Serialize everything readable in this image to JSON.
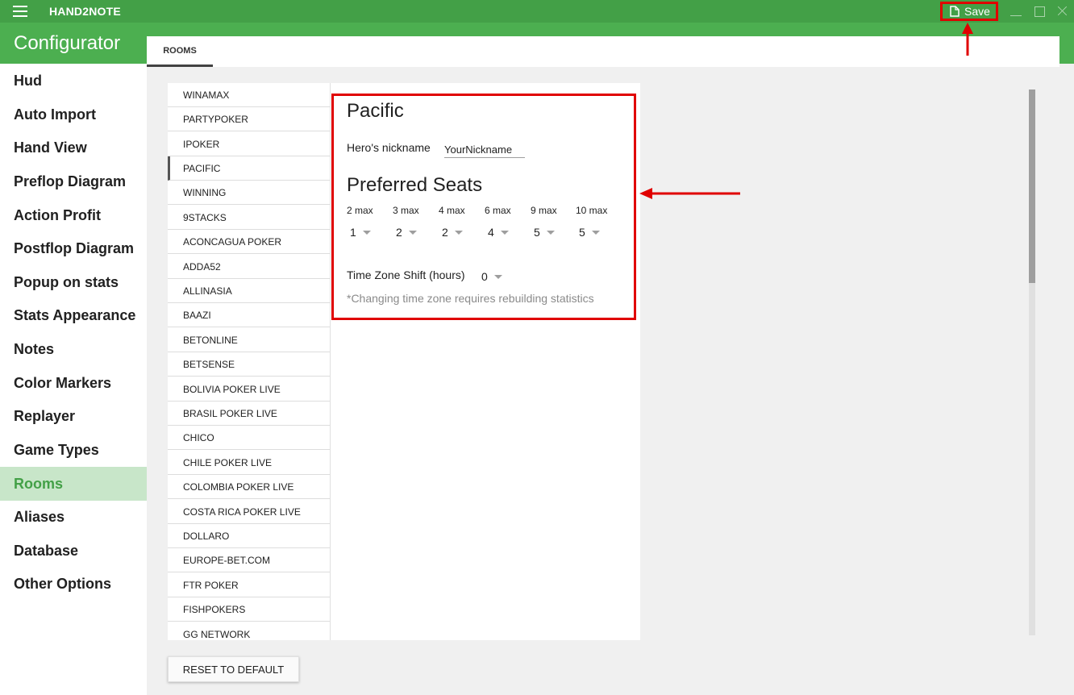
{
  "app": {
    "title": "HAND2NOTE",
    "save_label": "Save"
  },
  "header": {
    "title": "Configurator"
  },
  "sidebar": {
    "items": [
      {
        "label": "Hud"
      },
      {
        "label": "Auto Import"
      },
      {
        "label": "Hand View"
      },
      {
        "label": "Preflop Diagram"
      },
      {
        "label": "Action Profit"
      },
      {
        "label": "Postflop Diagram"
      },
      {
        "label": "Popup on stats"
      },
      {
        "label": "Stats Appearance"
      },
      {
        "label": "Notes"
      },
      {
        "label": "Color Markers"
      },
      {
        "label": "Replayer"
      },
      {
        "label": "Game Types"
      },
      {
        "label": "Rooms",
        "active": true
      },
      {
        "label": "Aliases"
      },
      {
        "label": "Database"
      },
      {
        "label": "Other Options"
      }
    ]
  },
  "tabs": [
    {
      "label": "ROOMS",
      "active": true
    }
  ],
  "rooms": [
    "WINAMAX",
    "PARTYPOKER",
    "IPOKER",
    "PACIFIC",
    "WINNING",
    "9STACKS",
    "ACONCAGUA POKER",
    "ADDA52",
    "ALLINASIA",
    "BAAZI",
    "BETONLINE",
    "BETSENSE",
    "BOLIVIA POKER LIVE",
    "BRASIL POKER LIVE",
    "CHICO",
    "CHILE POKER LIVE",
    "COLOMBIA POKER LIVE",
    "COSTA RICA POKER LIVE",
    "DOLLARO",
    "EUROPE-BET.COM",
    "FTR POKER",
    "FISHPOKERS",
    "GG NETWORK"
  ],
  "selected_room": "PACIFIC",
  "detail": {
    "title": "Pacific",
    "nickname_label": "Hero's nickname",
    "nickname_value": "YourNickname",
    "seats_title": "Preferred Seats",
    "seats": [
      {
        "label": "2 max",
        "value": "1"
      },
      {
        "label": "3 max",
        "value": "2"
      },
      {
        "label": "4 max",
        "value": "2"
      },
      {
        "label": "6 max",
        "value": "4"
      },
      {
        "label": "9 max",
        "value": "5"
      },
      {
        "label": "10 max",
        "value": "5"
      }
    ],
    "timezone_label": "Time Zone Shift (hours)",
    "timezone_value": "0",
    "timezone_note": "*Changing time zone requires rebuilding statistics"
  },
  "reset_label": "RESET TO DEFAULT",
  "colors": {
    "primary": "#4caf50",
    "titlebar": "#43a047",
    "active_bg": "#c8e6c9",
    "highlight": "#e00000"
  }
}
